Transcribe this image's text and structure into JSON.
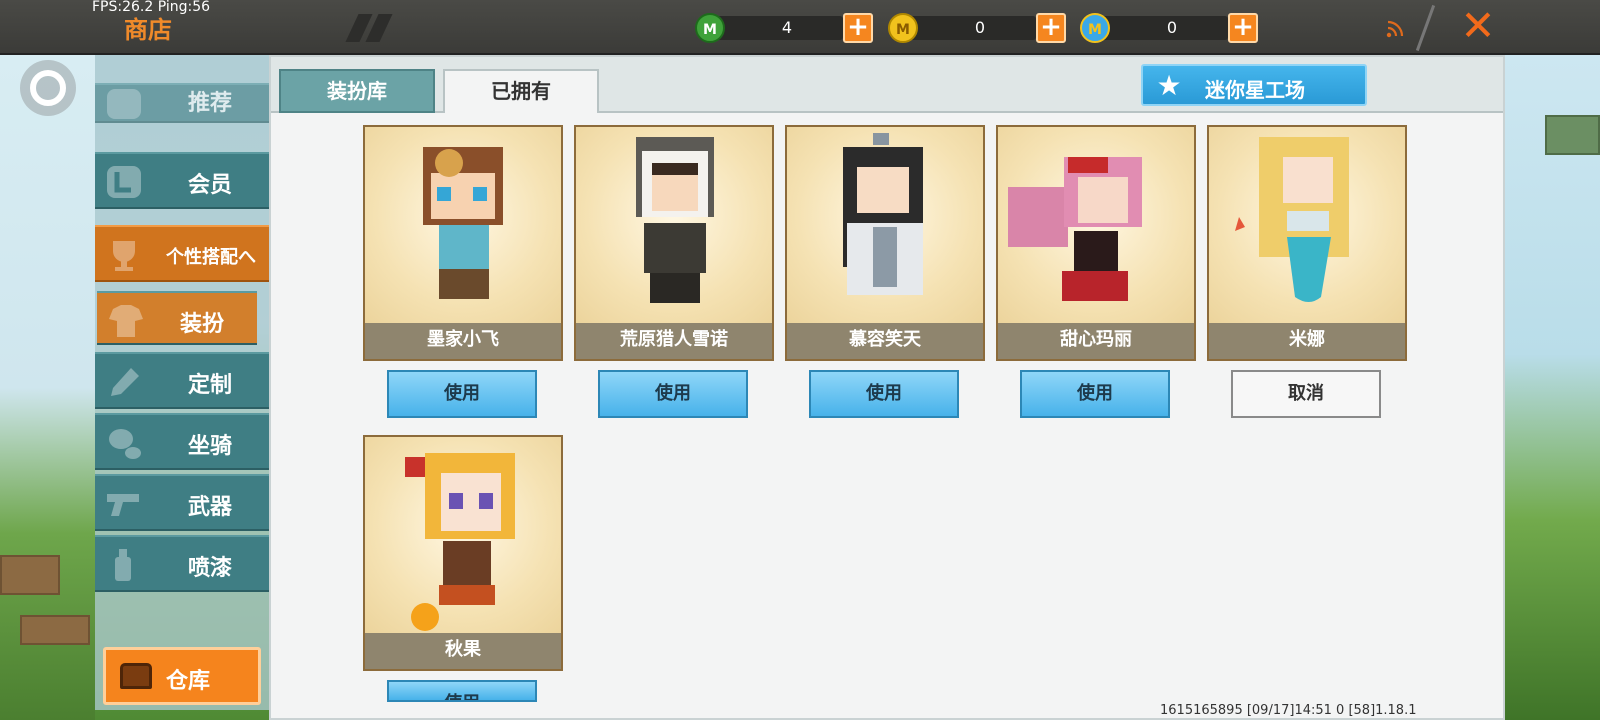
{
  "debug": {
    "fps_label": "FPS:26.2  Ping:56"
  },
  "header": {
    "title": "商店"
  },
  "currencies": [
    {
      "icon": "green-gem-icon",
      "value": "4",
      "color": "#3fa23a"
    },
    {
      "icon": "gold-coin-icon",
      "value": "0",
      "color": "#f1c21d"
    },
    {
      "icon": "mini-coin-icon",
      "value": "0",
      "color": "#3aa8e8"
    }
  ],
  "sidebar": {
    "items": [
      {
        "label": "推荐",
        "icon": "thumb-icon"
      },
      {
        "label": "会员",
        "icon": "member-icon"
      },
      {
        "label": "个性搭配へ",
        "icon": "trophy-icon"
      },
      {
        "label": "装扮",
        "icon": "outfit-icon"
      },
      {
        "label": "定制",
        "icon": "pencil-icon"
      },
      {
        "label": "坐骑",
        "icon": "mount-icon"
      },
      {
        "label": "武器",
        "icon": "gun-icon"
      },
      {
        "label": "喷漆",
        "icon": "spray-icon"
      }
    ],
    "warehouse_label": "仓库"
  },
  "tabs": [
    {
      "label": "装扮库"
    },
    {
      "label": "已拥有"
    }
  ],
  "workshop_label": "迷你星工场",
  "skins": [
    {
      "name": "墨家小飞",
      "action": "使用"
    },
    {
      "name": "荒原猎人雪诺",
      "action": "使用"
    },
    {
      "name": "慕容笑天",
      "action": "使用"
    },
    {
      "name": "甜心玛丽",
      "action": "使用"
    },
    {
      "name": "米娜",
      "action": "取消"
    },
    {
      "name": "秋果",
      "action": "使用"
    }
  ],
  "footer": {
    "info": "1615165895    [09/17]14:51 0    [58]1.18.1"
  },
  "colors": {
    "accent": "#f5841d",
    "teal": "#3f7e84",
    "blue": "#47b2ea"
  }
}
